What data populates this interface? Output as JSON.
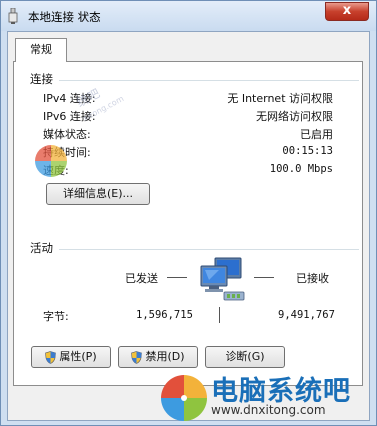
{
  "window": {
    "title": "本地连接 状态",
    "close_glyph": "x"
  },
  "tabs": [
    {
      "label": "常规"
    }
  ],
  "connection": {
    "heading": "连接",
    "rows": [
      {
        "label": "IPv4 连接:",
        "value": "无 Internet 访问权限"
      },
      {
        "label": "IPv6 连接:",
        "value": "无网络访问权限"
      },
      {
        "label": "媒体状态:",
        "value": "已启用"
      },
      {
        "label": "持续时间:",
        "value": "00:15:13"
      },
      {
        "label": "速度:",
        "value": "100.0 Mbps"
      }
    ],
    "details_button": "详细信息(E)..."
  },
  "activity": {
    "heading": "活动",
    "sent_label": "已发送",
    "received_label": "已接收",
    "bytes_label": "字节:",
    "bytes_sent": "1,596,715",
    "bytes_received": "9,491,767"
  },
  "buttons": {
    "properties": "属性(P)",
    "disable": "禁用(D)",
    "diagnose": "诊断(G)"
  },
  "watermark": {
    "brand": "电脑系统吧",
    "url": "www.dnxitong.com",
    "overlay_text": "统吧",
    "overlay_sub": "xitong.com"
  },
  "colors": {
    "close_red": "#c7402c",
    "brand_blue": "#1a6fb8"
  }
}
